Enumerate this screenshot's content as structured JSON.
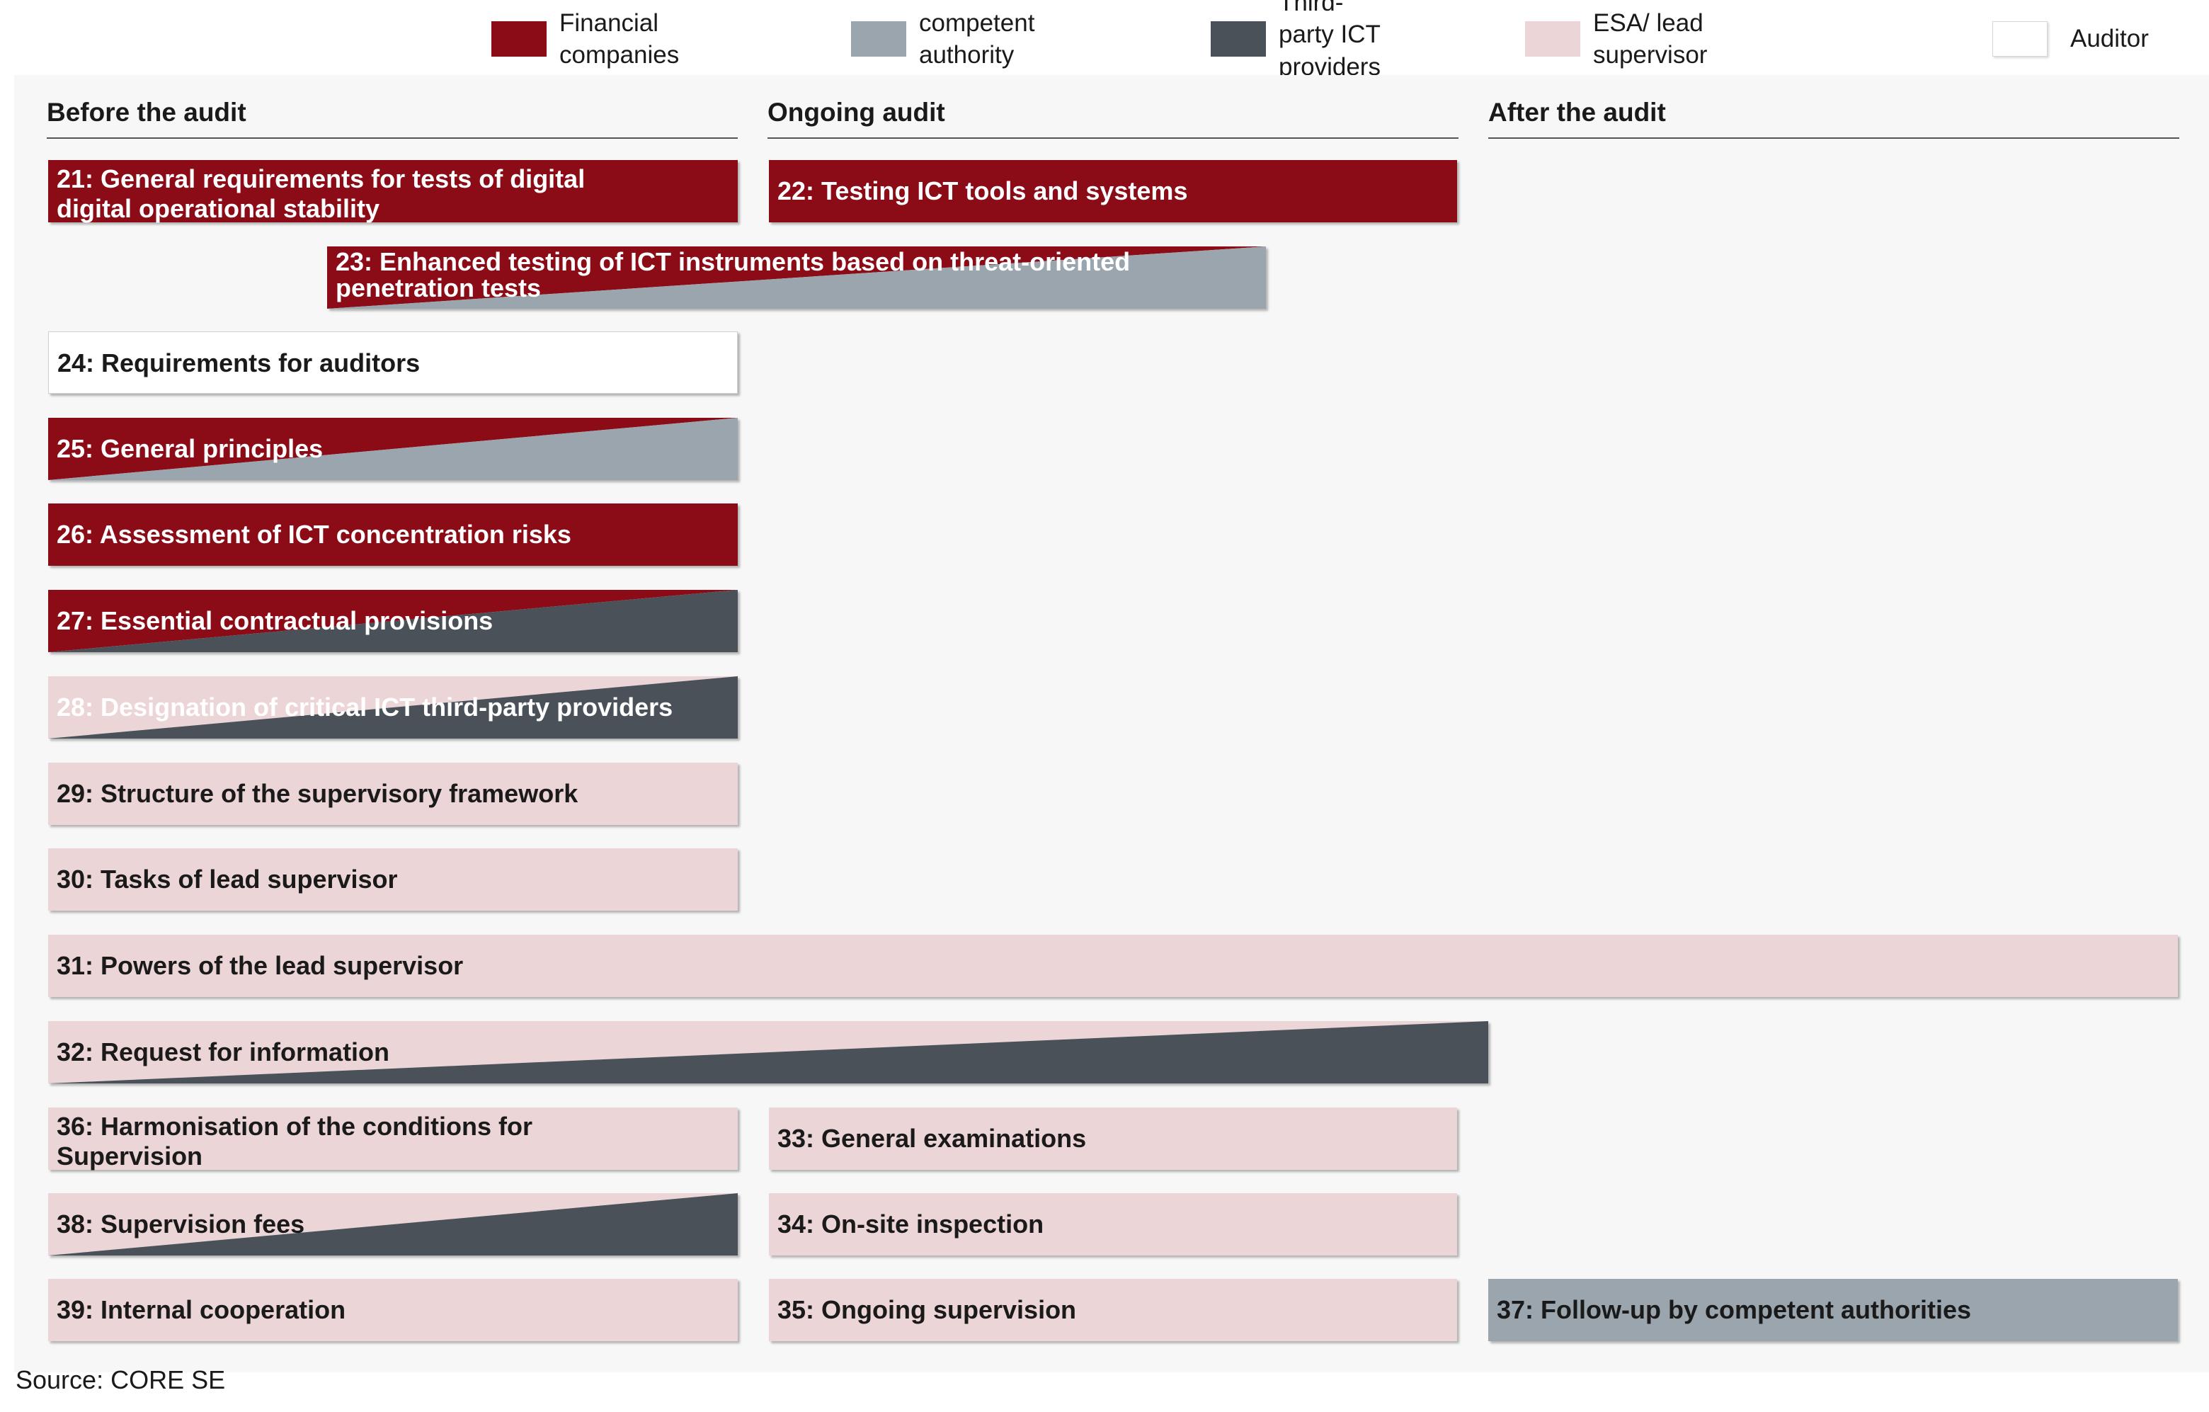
{
  "colors": {
    "financial": "#8b0b17",
    "authority": "#9aa5ad",
    "ict": "#4a5159",
    "esa": "#ecd5d7",
    "auditor": "#ffffff"
  },
  "legend": [
    {
      "label": "Financial companies",
      "color": "#8b0b17"
    },
    {
      "label": "competent authority",
      "color": "#9aa5ad"
    },
    {
      "label": "Third-party ICT\nproviders",
      "color": "#4a5159"
    },
    {
      "label": "ESA/ lead supervisor",
      "color": "#ecd5d7"
    },
    {
      "label": "Auditor",
      "color": "#ffffff"
    }
  ],
  "phases": {
    "before": "Before the audit",
    "ongoing": "Ongoing audit",
    "after": "After the audit"
  },
  "items": [
    {
      "label": "21: General requirements for tests of digital\n      digital operational stability",
      "fill": "financial",
      "text": "light"
    },
    {
      "label": "22: Testing ICT tools and systems",
      "fill": "financial",
      "text": "light"
    },
    {
      "label": "23: Enhanced testing of ICT instruments based on threat-oriented\n      penetration tests",
      "fill": "financial",
      "second": "authority",
      "text": "light"
    },
    {
      "label": "24: Requirements for auditors",
      "fill": "auditor",
      "text": "dark"
    },
    {
      "label": "25: General principles",
      "fill": "financial",
      "second": "authority",
      "text": "light"
    },
    {
      "label": "26: Assessment of ICT concentration risks",
      "fill": "financial",
      "text": "light"
    },
    {
      "label": "27: Essential contractual provisions",
      "fill": "financial",
      "second": "ict",
      "text": "light"
    },
    {
      "label": "28: Designation of critical ICT third-party providers",
      "fill": "esa",
      "second": "ict",
      "text": "light"
    },
    {
      "label": "29: Structure of the supervisory framework",
      "fill": "esa",
      "text": "dark"
    },
    {
      "label": "30: Tasks of lead supervisor",
      "fill": "esa",
      "text": "dark"
    },
    {
      "label": "31: Powers of the lead supervisor",
      "fill": "esa",
      "text": "dark"
    },
    {
      "label": "32: Request for information",
      "fill": "esa",
      "second": "ict",
      "text": "dark"
    },
    {
      "label": "36: Harmonisation of the conditions for\n      Supervision",
      "fill": "esa",
      "text": "dark"
    },
    {
      "label": "33: General examinations",
      "fill": "esa",
      "text": "dark"
    },
    {
      "label": "38: Supervision fees",
      "fill": "esa",
      "second": "ict",
      "text": "dark"
    },
    {
      "label": "34: On-site inspection",
      "fill": "esa",
      "text": "dark"
    },
    {
      "label": "39: Internal cooperation",
      "fill": "esa",
      "text": "dark"
    },
    {
      "label": "35: Ongoing supervision",
      "fill": "esa",
      "text": "dark"
    },
    {
      "label": "37: Follow-up by competent authorities",
      "fill": "authority",
      "text": "dark"
    }
  ],
  "source": "Source: CORE SE"
}
